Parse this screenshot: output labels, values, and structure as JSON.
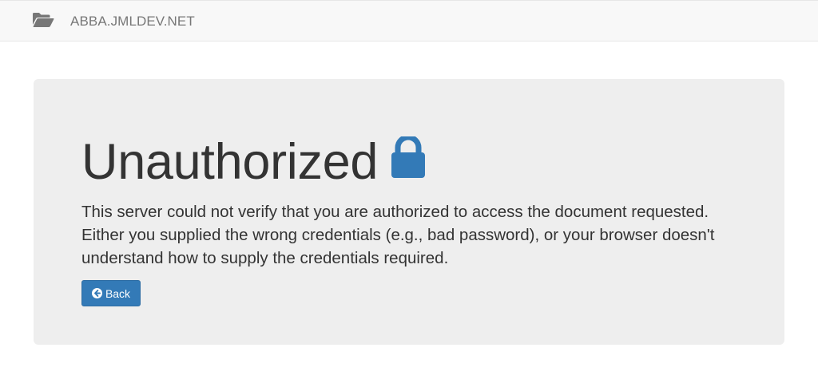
{
  "navbar": {
    "brand_icon": "folder-open-icon",
    "brand_text": "ABBA.JMLDEV.NET"
  },
  "error": {
    "title": "Unauthorized",
    "title_icon": "lock-icon",
    "message": "This server could not verify that you are authorized to access the document requested. Either you supplied the wrong credentials (e.g., bad password), or your browser doesn't understand how to supply the credentials required.",
    "back_label": "Back",
    "back_icon": "arrow-left-icon"
  },
  "colors": {
    "accent": "#337ab7",
    "panel_background": "#eeeeee",
    "navbar_background": "#f8f8f8",
    "brand_text": "#777777"
  }
}
